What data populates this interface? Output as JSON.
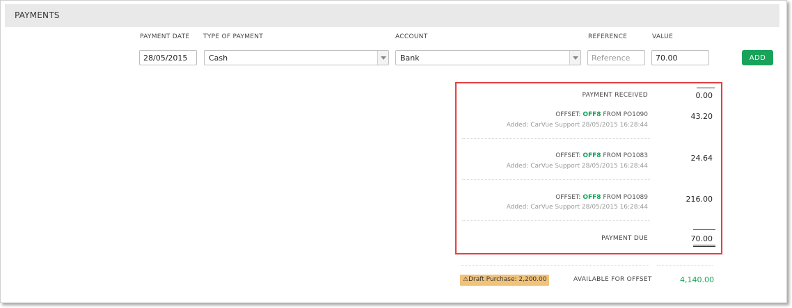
{
  "section": {
    "title": "PAYMENTS"
  },
  "form": {
    "labels": {
      "payment_date": "PAYMENT DATE",
      "type_of_payment": "TYPE OF PAYMENT",
      "account": "ACCOUNT",
      "reference": "REFERENCE",
      "value": "VALUE"
    },
    "payment_date": "28/05/2015",
    "type_of_payment": "Cash",
    "account": "Bank",
    "reference_placeholder": "Reference",
    "value": "70.00",
    "add_label": "ADD"
  },
  "summary": {
    "payment_received_label": "PAYMENT RECEIVED",
    "payment_received_value": "0.00",
    "offset_prefix": "OFFSET:",
    "offset_from": "FROM",
    "offsets": [
      {
        "code": "OFF8",
        "po": "PO1090",
        "added": "Added: CarVue Support 28/05/2015 16:28:44",
        "amount": "43.20"
      },
      {
        "code": "OFF8",
        "po": "PO1083",
        "added": "Added: CarVue Support 28/05/2015 16:28:44",
        "amount": "24.64"
      },
      {
        "code": "OFF8",
        "po": "PO1089",
        "added": "Added: CarVue Support 28/05/2015 16:28:44",
        "amount": "216.00"
      }
    ],
    "payment_due_label": "PAYMENT DUE",
    "payment_due_value": "70.00"
  },
  "footer": {
    "draft_badge": "Draft Purchase: 2,200.00",
    "available_label": "AVAILABLE FOR OFFSET",
    "available_value": "4,140.00"
  },
  "colors": {
    "accent_green": "#18a35a",
    "highlight_red": "#e0423f",
    "badge_orange": "#f1c27a",
    "header_gray": "#e9e9e9"
  },
  "icons": {
    "draft_badge_icon": "warning-triangle-icon"
  }
}
